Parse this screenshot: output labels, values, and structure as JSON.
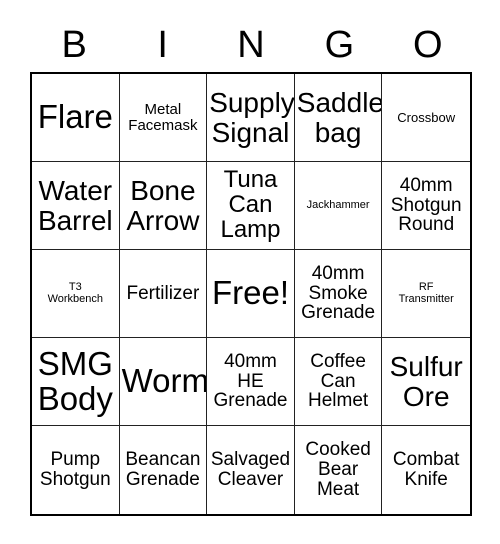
{
  "header": {
    "letters": [
      "B",
      "I",
      "N",
      "G",
      "O"
    ]
  },
  "grid": {
    "rows": [
      [
        {
          "label": "Flare",
          "size": "xxl"
        },
        {
          "label": "Metal\nFacemask",
          "size": "sm"
        },
        {
          "label": "Supply\nSignal",
          "size": "xl"
        },
        {
          "label": "Saddle\nbag",
          "size": "xl"
        },
        {
          "label": "Crossbow",
          "size": "xs"
        }
      ],
      [
        {
          "label": "Water\nBarrel",
          "size": "xl"
        },
        {
          "label": "Bone\nArrow",
          "size": "xl"
        },
        {
          "label": "Tuna\nCan\nLamp",
          "size": "lg"
        },
        {
          "label": "Jackhammer",
          "size": "xxs"
        },
        {
          "label": "40mm\nShotgun\nRound",
          "size": "md"
        }
      ],
      [
        {
          "label": "T3\nWorkbench",
          "size": "xxs"
        },
        {
          "label": "Fertilizer",
          "size": "md"
        },
        {
          "label": "Free!",
          "size": "xxl"
        },
        {
          "label": "40mm\nSmoke\nGrenade",
          "size": "md"
        },
        {
          "label": "RF\nTransmitter",
          "size": "xxs"
        }
      ],
      [
        {
          "label": "SMG\nBody",
          "size": "xxl"
        },
        {
          "label": "Worm",
          "size": "xxl"
        },
        {
          "label": "40mm\nHE\nGrenade",
          "size": "md"
        },
        {
          "label": "Coffee\nCan\nHelmet",
          "size": "md"
        },
        {
          "label": "Sulfur\nOre",
          "size": "xl"
        }
      ],
      [
        {
          "label": "Pump\nShotgun",
          "size": "md"
        },
        {
          "label": "Beancan\nGrenade",
          "size": "md"
        },
        {
          "label": "Salvaged\nCleaver",
          "size": "md"
        },
        {
          "label": "Cooked\nBear\nMeat",
          "size": "md"
        },
        {
          "label": "Combat\nKnife",
          "size": "md"
        }
      ]
    ],
    "free_space": {
      "row": 2,
      "col": 2
    }
  },
  "colors": {
    "background": "#ffffff",
    "text": "#000000",
    "grid_line": "#222222",
    "outer_border": "#000000"
  }
}
